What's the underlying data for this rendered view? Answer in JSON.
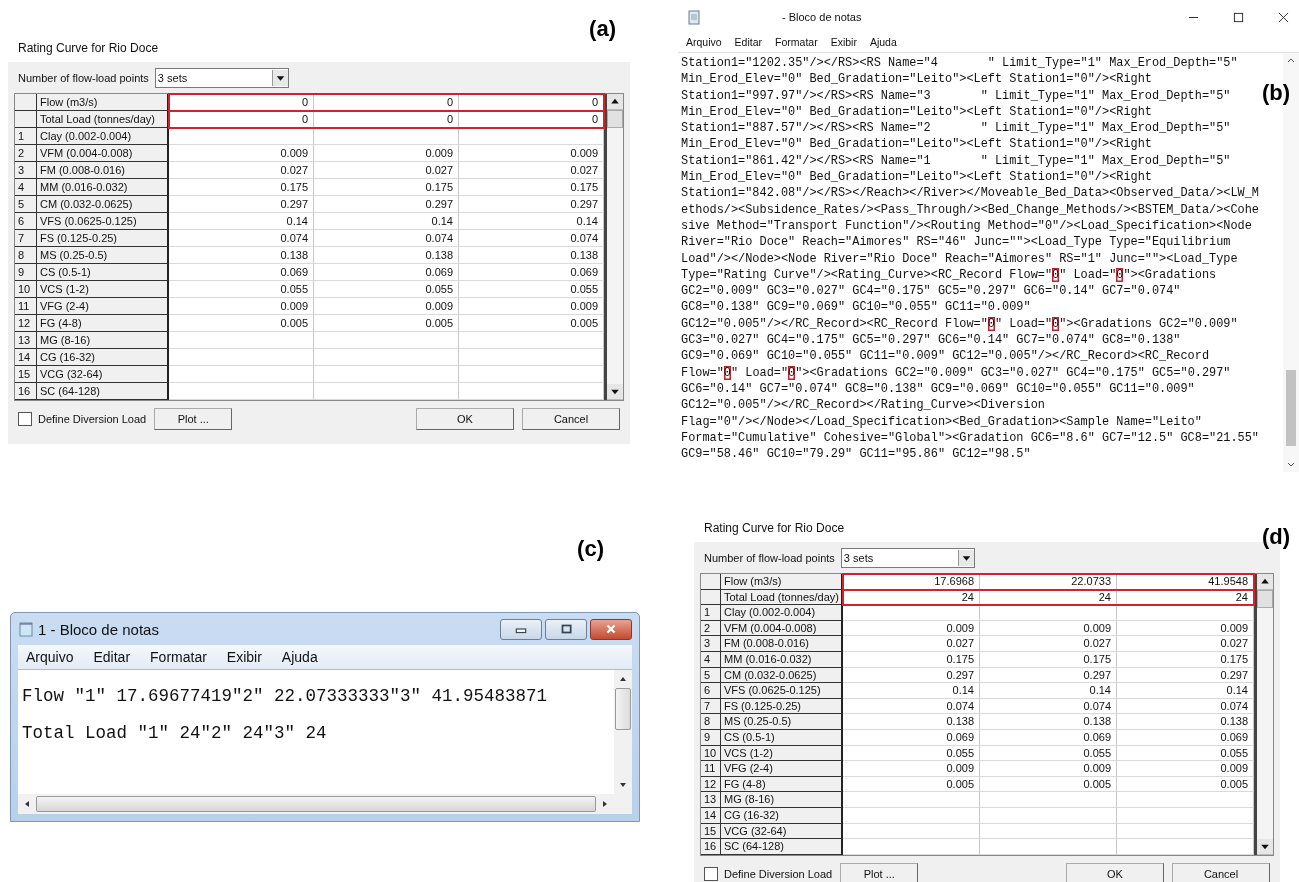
{
  "panels": [
    {
      "kind": "dialog",
      "label": "(a)",
      "title": "Rating Curve for Rio Doce",
      "points_label": "Number of flow-load points",
      "points_value": "3 sets",
      "rows": [
        {
          "label": "Flow (m3/s)",
          "values": [
            "0",
            "0",
            "0"
          ],
          "highlighted": true
        },
        {
          "label": "Total Load (tonnes/day)",
          "values": [
            "0",
            "0",
            "0"
          ],
          "highlighted": true
        },
        {
          "number": "1",
          "label": "Clay (0.002-0.004)",
          "highlighted": false
        },
        {
          "number": "2",
          "label": "VFM (0.004-0.008)",
          "values": [
            "0.009",
            "0.009",
            "0.009"
          ],
          "highlighted": false
        },
        {
          "number": "3",
          "label": "FM (0.008-0.016)",
          "values": [
            "0.027",
            "0.027",
            "0.027"
          ],
          "highlighted": false
        },
        {
          "number": "4",
          "label": "MM (0.016-0.032)",
          "values": [
            "0.175",
            "0.175",
            "0.175"
          ],
          "highlighted": false
        },
        {
          "number": "5",
          "label": "CM (0.032-0.0625)",
          "values": [
            "0.297",
            "0.297",
            "0.297"
          ],
          "highlighted": false
        },
        {
          "number": "6",
          "label": "VFS (0.0625-0.125)",
          "values": [
            "0.14",
            "0.14",
            "0.14"
          ],
          "highlighted": false
        },
        {
          "number": "7",
          "label": "FS (0.125-0.25)",
          "values": [
            "0.074",
            "0.074",
            "0.074"
          ],
          "highlighted": false
        },
        {
          "number": "8",
          "label": "MS (0.25-0.5)",
          "values": [
            "0.138",
            "0.138",
            "0.138"
          ],
          "highlighted": false
        },
        {
          "number": "9",
          "label": "CS (0.5-1)",
          "values": [
            "0.069",
            "0.069",
            "0.069"
          ],
          "highlighted": false
        },
        {
          "number": "10",
          "label": "VCS (1-2)",
          "values": [
            "0.055",
            "0.055",
            "0.055"
          ],
          "highlighted": false
        },
        {
          "number": "11",
          "label": "VFG (2-4)",
          "values": [
            "0.009",
            "0.009",
            "0.009"
          ],
          "highlighted": false
        },
        {
          "number": "12",
          "label": "FG (4-8)",
          "values": [
            "0.005",
            "0.005",
            "0.005"
          ],
          "highlighted": false
        },
        {
          "number": "13",
          "label": "MG (8-16)",
          "highlighted": false
        },
        {
          "number": "14",
          "label": "CG (16-32)",
          "highlighted": false
        },
        {
          "number": "15",
          "label": "VCG (32-64)",
          "highlighted": false
        },
        {
          "number": "16",
          "label": "SC (64-128)",
          "highlighted": false
        }
      ],
      "checkbox": {
        "label": "Define Diversion Load",
        "checked": false
      },
      "buttons": [
        "Plot ...",
        "OK",
        "Cancel"
      ]
    },
    {
      "kind": "notepad_modern",
      "label": "(b)",
      "title": "- Bloco de notas",
      "menu": [
        "Arquivo",
        "Editar",
        "Formatar",
        "Exibir",
        "Ajuda"
      ],
      "lines": [
        [
          {
            "text": "Station1=\"1202.35\"/></RS><RS Name=\"4       \" Limit_Type=\"1\" Max_Erod_Depth=\"5\"",
            "boxed": false
          }
        ],
        [
          {
            "text": "Min_Erod_Elev=\"0\" Bed_Gradation=\"Leito\"><Left Station1=\"0\"/><Right",
            "boxed": false
          }
        ],
        [
          {
            "text": "Station1=\"997.97\"/></RS><RS Name=\"3       \" Limit_Type=\"1\" Max_Erod_Depth=\"5\"",
            "boxed": false
          }
        ],
        [
          {
            "text": "Min_Erod_Elev=\"0\" Bed_Gradation=\"Leito\"><Left Station1=\"0\"/><Right",
            "boxed": false
          }
        ],
        [
          {
            "text": "Station1=\"887.57\"/></RS><RS Name=\"2       \" Limit_Type=\"1\" Max_Erod_Depth=\"5\"",
            "boxed": false
          }
        ],
        [
          {
            "text": "Min_Erod_Elev=\"0\" Bed_Gradation=\"Leito\"><Left Station1=\"0\"/><Right",
            "boxed": false
          }
        ],
        [
          {
            "text": "Station1=\"861.42\"/></RS><RS Name=\"1       \" Limit_Type=\"1\" Max_Erod_Depth=\"5\"",
            "boxed": false
          }
        ],
        [
          {
            "text": "Min_Erod_Elev=\"0\" Bed_Gradation=\"Leito\"><Left Station1=\"0\"/><Right",
            "boxed": false
          }
        ],
        [
          {
            "text": "Station1=\"842.08\"/></RS></Reach></River></Moveable_Bed_Data><Observed_Data/><LW_M",
            "boxed": false
          }
        ],
        [
          {
            "text": "ethods/><Subsidence_Rates/><Pass_Through/><Bed_Change_Methods/><BSTEM_Data/><Cohe",
            "boxed": false
          }
        ],
        [
          {
            "text": "sive Method=\"Transport Function\"/><Routing Method=\"0\"/><Load_Specification><Node",
            "boxed": false
          }
        ],
        [
          {
            "text": "River=\"Rio Doce\" Reach=\"Aimores\" RS=\"46\" Junc=\"\"><Load_Type Type=\"Equilibrium",
            "boxed": false
          }
        ],
        [
          {
            "text": "Load\"/></Node><Node River=\"Rio Doce\" Reach=\"Aimores\" RS=\"1\" Junc=\"\"><Load_Type",
            "boxed": false
          }
        ],
        [
          {
            "text": "Type=\"Rating Curve\"/><Rating_Curve><RC_Record Flow=\"",
            "boxed": false
          },
          {
            "text": "0",
            "boxed": true
          },
          {
            "text": "\" Load=\"",
            "boxed": false
          },
          {
            "text": "0",
            "boxed": true
          },
          {
            "text": "\"><Gradations",
            "boxed": false
          }
        ],
        [
          {
            "text": "GC2=\"0.009\" GC3=\"0.027\" GC4=\"0.175\" GC5=\"0.297\" GC6=\"0.14\" GC7=\"0.074\"",
            "boxed": false
          }
        ],
        [
          {
            "text": "GC8=\"0.138\" GC9=\"0.069\" GC10=\"0.055\" GC11=\"0.009\"",
            "boxed": false
          }
        ],
        [
          {
            "text": "GC12=\"0.005\"/></RC_Record><RC_Record Flow=\"",
            "boxed": false
          },
          {
            "text": "0",
            "boxed": true
          },
          {
            "text": "\" Load=\"",
            "boxed": false
          },
          {
            "text": "0",
            "boxed": true
          },
          {
            "text": "\"><Gradations GC2=\"0.009\"",
            "boxed": false
          }
        ],
        [
          {
            "text": "GC3=\"0.027\" GC4=\"0.175\" GC5=\"0.297\" GC6=\"0.14\" GC7=\"0.074\" GC8=\"0.138\"",
            "boxed": false
          }
        ],
        [
          {
            "text": "GC9=\"0.069\" GC10=\"0.055\" GC11=\"0.009\" GC12=\"0.005\"/></RC_Record><RC_Record",
            "boxed": false
          }
        ],
        [
          {
            "text": "Flow=\"",
            "boxed": false
          },
          {
            "text": "0",
            "boxed": true
          },
          {
            "text": "\" Load=\"",
            "boxed": false
          },
          {
            "text": "0",
            "boxed": true
          },
          {
            "text": "\"><Gradations GC2=\"0.009\" GC3=\"0.027\" GC4=\"0.175\" GC5=\"0.297\"",
            "boxed": false
          }
        ],
        [
          {
            "text": "GC6=\"0.14\" GC7=\"0.074\" GC8=\"0.138\" GC9=\"0.069\" GC10=\"0.055\" GC11=\"0.009\"",
            "boxed": false
          }
        ],
        [
          {
            "text": "GC12=\"0.005\"/></RC_Record></Rating_Curve><Diversion",
            "boxed": false
          }
        ],
        [
          {
            "text": "Flag=\"0\"/></Node></Load_Specification><Bed_Gradation><Sample Name=\"Leito\"",
            "boxed": false
          }
        ],
        [
          {
            "text": "Format=\"Cumulative\" Cohesive=\"Global\"><Gradation GC6=\"8.6\" GC7=\"12.5\" GC8=\"21.55\"",
            "boxed": false
          }
        ],
        [
          {
            "text": "GC9=\"58.46\" GC10=\"79.29\" GC11=\"95.86\" GC12=\"98.5\"",
            "boxed": false
          }
        ]
      ]
    },
    {
      "kind": "notepad_classic",
      "label": "(c)",
      "title": "1 - Bloco de notas",
      "menu": [
        "Arquivo",
        "Editar",
        "Formatar",
        "Exibir",
        "Ajuda"
      ],
      "lines": [
        "Flow \"1\" 17.69677419\"2\" 22.07333333\"3\" 41.95483871",
        "Total Load \"1\" 24\"2\" 24\"3\" 24"
      ]
    },
    {
      "kind": "dialog",
      "label": "(d)",
      "title": "Rating Curve for Rio Doce",
      "points_label": "Number of flow-load points",
      "points_value": "3 sets",
      "rows": [
        {
          "label": "Flow (m3/s)",
          "values": [
            "17.6968",
            "22.0733",
            "41.9548"
          ],
          "highlighted": true
        },
        {
          "label": "Total Load (tonnes/day)",
          "values": [
            "24",
            "24",
            "24"
          ],
          "highlighted": true
        },
        {
          "number": "1",
          "label": "Clay (0.002-0.004)",
          "highlighted": false
        },
        {
          "number": "2",
          "label": "VFM (0.004-0.008)",
          "values": [
            "0.009",
            "0.009",
            "0.009"
          ],
          "highlighted": false
        },
        {
          "number": "3",
          "label": "FM (0.008-0.016)",
          "values": [
            "0.027",
            "0.027",
            "0.027"
          ],
          "highlighted": false
        },
        {
          "number": "4",
          "label": "MM (0.016-0.032)",
          "values": [
            "0.175",
            "0.175",
            "0.175"
          ],
          "highlighted": false
        },
        {
          "number": "5",
          "label": "CM (0.032-0.0625)",
          "values": [
            "0.297",
            "0.297",
            "0.297"
          ],
          "highlighted": false
        },
        {
          "number": "6",
          "label": "VFS (0.0625-0.125)",
          "values": [
            "0.14",
            "0.14",
            "0.14"
          ],
          "highlighted": false
        },
        {
          "number": "7",
          "label": "FS (0.125-0.25)",
          "values": [
            "0.074",
            "0.074",
            "0.074"
          ],
          "highlighted": false
        },
        {
          "number": "8",
          "label": "MS (0.25-0.5)",
          "values": [
            "0.138",
            "0.138",
            "0.138"
          ],
          "highlighted": false
        },
        {
          "number": "9",
          "label": "CS (0.5-1)",
          "values": [
            "0.069",
            "0.069",
            "0.069"
          ],
          "highlighted": false
        },
        {
          "number": "10",
          "label": "VCS (1-2)",
          "values": [
            "0.055",
            "0.055",
            "0.055"
          ],
          "highlighted": false
        },
        {
          "number": "11",
          "label": "VFG (2-4)",
          "values": [
            "0.009",
            "0.009",
            "0.009"
          ],
          "highlighted": false
        },
        {
          "number": "12",
          "label": "FG (4-8)",
          "values": [
            "0.005",
            "0.005",
            "0.005"
          ],
          "highlighted": false
        },
        {
          "number": "13",
          "label": "MG (8-16)",
          "highlighted": false
        },
        {
          "number": "14",
          "label": "CG (16-32)",
          "highlighted": false
        },
        {
          "number": "15",
          "label": "VCG (32-64)",
          "highlighted": false
        },
        {
          "number": "16",
          "label": "SC (64-128)",
          "highlighted": false
        }
      ],
      "checkbox": {
        "label": "Define Diversion Load",
        "checked": false
      },
      "buttons": [
        "Plot ...",
        "OK",
        "Cancel"
      ]
    }
  ]
}
